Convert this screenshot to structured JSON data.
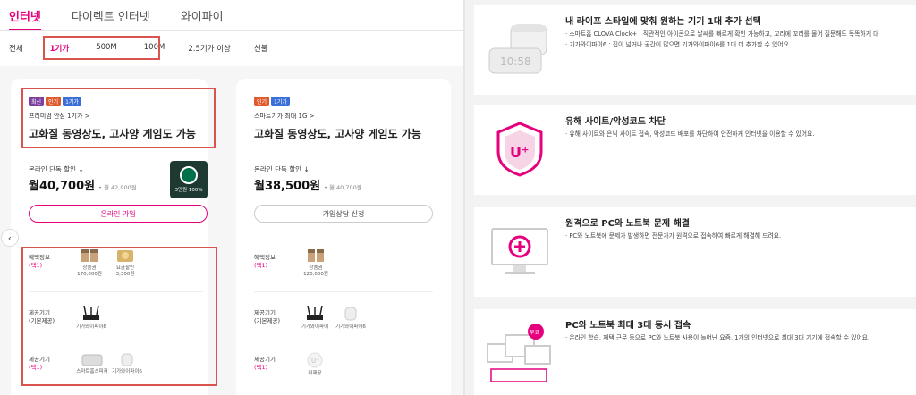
{
  "tabs": [
    "인터넷",
    "다이렉트 인터넷",
    "와이파이"
  ],
  "subtabs": [
    "전체",
    "1기가",
    "500M",
    "100M",
    "2.5기가 이상",
    "선불"
  ],
  "colors": {
    "accent": "#e6007e",
    "highlight_box": "#d9534f",
    "badge_new": "#7b3fa0",
    "badge_hot": "#e05a2b",
    "badge_giga": "#3b6fd8"
  },
  "card1": {
    "badges": [
      "최신",
      "인기",
      "1기가"
    ],
    "subtitle": "프리미엄 안심 1기가 >",
    "headline": "고화질 동영상도, 고사양 게임도 가능",
    "sale_label": "온라인 단독 할인 ↓",
    "price": "월40,700원",
    "orig_price": "• 월 42,900원",
    "starbucks_label": "3만원 100%",
    "button": "온라인 가입",
    "benefit_label": "혜택정보",
    "benefit_pick": "(택1)",
    "benefits": [
      {
        "name": "상품권",
        "value": "170,000원"
      },
      {
        "name": "요금할인",
        "value": "3,300원"
      }
    ],
    "device_basic_label": "제공기기",
    "device_basic_sub": "(기본제공)",
    "device_basic": "기가와이파이6",
    "device_pick_label": "제공기기",
    "device_pick_sub": "(택1)",
    "device_pick": [
      "스마트홈스피커",
      "기가와이파이6"
    ]
  },
  "card2": {
    "badges": [
      "인기",
      "1기가"
    ],
    "subtitle": "스마트기가 최대 1G >",
    "headline": "고화질 동영상도, 고사양 게임도 가능",
    "sale_label": "온라인 단독 할인 ↓",
    "price": "월38,500원",
    "orig_price": "• 월 40,700원",
    "button": "가입상담 신청",
    "benefit_label": "혜택정보",
    "benefit_pick": "(택1)",
    "benefits": [
      {
        "name": "상품권",
        "value": "120,000원"
      }
    ],
    "device_basic_label": "제공기기",
    "device_basic_sub": "(기본제공)",
    "device_basic": [
      "기가와이파이",
      "기가와이파이6"
    ],
    "device_pick_label": "제공기기",
    "device_pick_sub": "(택1)",
    "device_pick": [
      "미제공"
    ]
  },
  "features": [
    {
      "title": "내 라이프 스타일에 맞춰 원하는 기기 1대 추가 선택",
      "desc": [
        "· 스마트홈 CLOVA Clock+ : 직관적인 아이콘으로 날씨를 빠르게 확인 가능하고, 꼬리에 꼬리를 물어 질문해도 똑똑하게 대",
        "· 기가와이파이6 : 집이 넓거나 공간이 많으면 기가와이파이6를 1대 더 추가할 수 있어요."
      ],
      "icon": "clock-speaker-icon",
      "clock_text": "10:58"
    },
    {
      "title": "유해 사이트/악성코드 차단",
      "desc": [
        "· 유해 사이트와 은닉 사이트 접속, 악성코드 배포를 차단하여 안전하게 인터넷을 이용할 수 있어요."
      ],
      "icon": "shield-u-plus-icon",
      "shield_text": "U⁺"
    },
    {
      "title": "원격으로 PC와 노트북 문제 해결",
      "desc": [
        "· PC와 노트북에 문제가 발생하면 전문가가 원격으로 접속하여 빠르게 해결해 드려요."
      ],
      "icon": "monitor-plus-icon"
    },
    {
      "title": "PC와 노트북 최대 3대 동시 접속",
      "desc": [
        "· 온라인 학습, 재택 근무 등으로 PC와 노트북 사용이 늘어난 요즘, 1개의 인터넷으로 최대 3대 기기에 접속할 수 있어요."
      ],
      "icon": "multi-device-icon",
      "free_badge": "무료"
    }
  ]
}
